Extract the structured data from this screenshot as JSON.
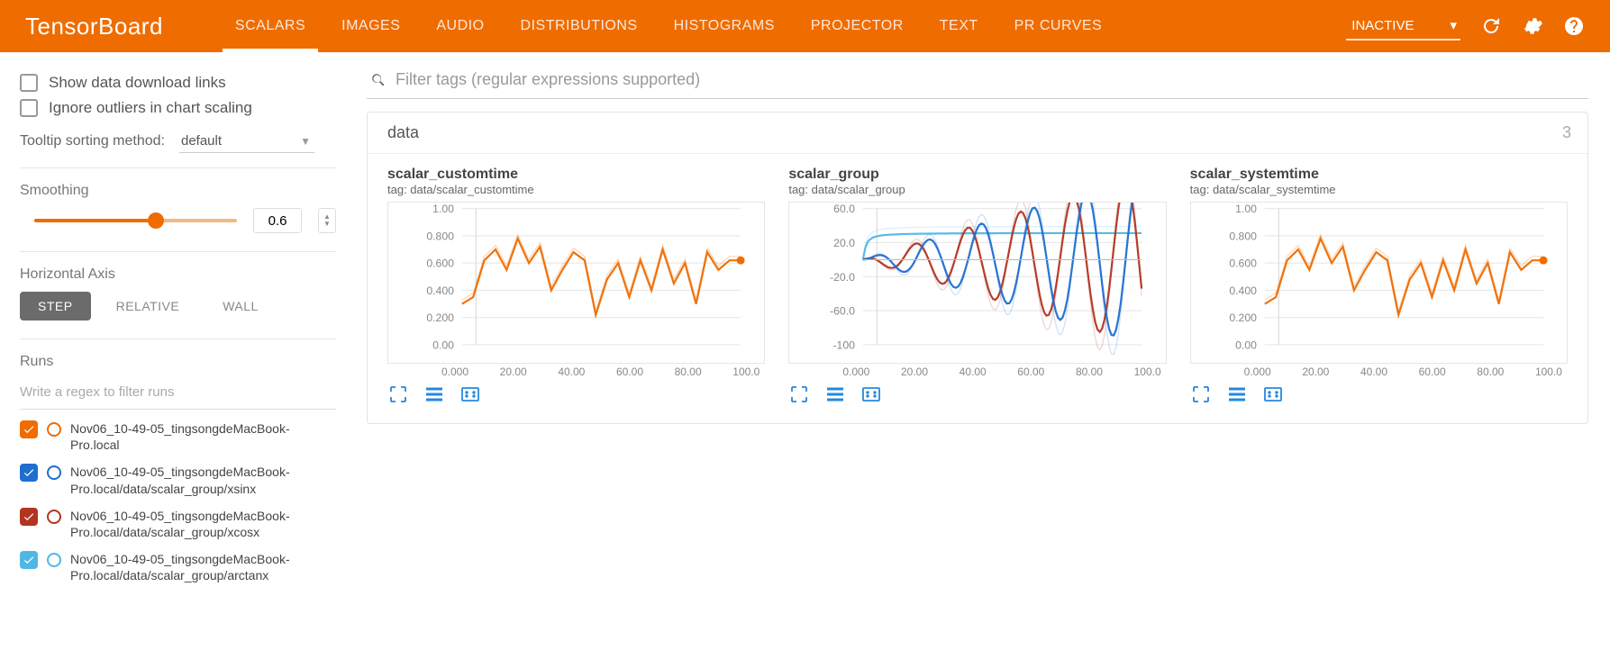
{
  "header": {
    "brand": "TensorBoard",
    "tabs": [
      "SCALARS",
      "IMAGES",
      "AUDIO",
      "DISTRIBUTIONS",
      "HISTOGRAMS",
      "PROJECTOR",
      "TEXT",
      "PR CURVES"
    ],
    "active_tab": 0,
    "inactive_label": "INACTIVE"
  },
  "sidebar": {
    "show_download": "Show data download links",
    "ignore_outliers": "Ignore outliers in chart scaling",
    "tooltip_label": "Tooltip sorting method:",
    "tooltip_value": "default",
    "smoothing_label": "Smoothing",
    "smoothing_value": "0.6",
    "smoothing_pct": 60,
    "haxis_label": "Horizontal Axis",
    "haxis_options": [
      "STEP",
      "RELATIVE",
      "WALL"
    ],
    "haxis_active": 0,
    "runs_label": "Runs",
    "runs_placeholder": "Write a regex to filter runs",
    "runs": [
      {
        "color": "#ef6c00",
        "label": "Nov06_10-49-05_tingsongdeMacBook-Pro.local"
      },
      {
        "color": "#1e6ecf",
        "label": "Nov06_10-49-05_tingsongdeMacBook-Pro.local/data/scalar_group/xsinx"
      },
      {
        "color": "#b23421",
        "label": "Nov06_10-49-05_tingsongdeMacBook-Pro.local/data/scalar_group/xcosx"
      },
      {
        "color": "#4fb7e6",
        "label": "Nov06_10-49-05_tingsongdeMacBook-Pro.local/data/scalar_group/arctanx"
      }
    ]
  },
  "content": {
    "filter_placeholder": "Filter tags (regular expressions supported)",
    "group_name": "data",
    "group_count": "3",
    "charts": [
      {
        "title": "scalar_customtime",
        "tag": "tag: data/scalar_customtime"
      },
      {
        "title": "scalar_group",
        "tag": "tag: data/scalar_group"
      },
      {
        "title": "scalar_systemtime",
        "tag": "tag: data/scalar_systemtime"
      }
    ]
  },
  "chart_data": [
    {
      "type": "line",
      "title": "scalar_customtime",
      "tag": "data/scalar_customtime",
      "xlim": [
        0,
        100
      ],
      "ylim": [
        0,
        1.0
      ],
      "yticks": [
        "1.00",
        "0.800",
        "0.600",
        "0.400",
        "0.200",
        "0.00"
      ],
      "xticks": [
        "0.000",
        "20.00",
        "40.00",
        "60.00",
        "80.00",
        "100.0"
      ],
      "series": [
        {
          "name": "Nov06_10-49-05",
          "color": "#ef6c00",
          "x": [
            0,
            4,
            8,
            12,
            16,
            20,
            24,
            28,
            32,
            36,
            40,
            44,
            48,
            52,
            56,
            60,
            64,
            68,
            72,
            76,
            80,
            84,
            88,
            92,
            96,
            100
          ],
          "values": [
            0.3,
            0.35,
            0.62,
            0.7,
            0.55,
            0.78,
            0.6,
            0.72,
            0.4,
            0.55,
            0.68,
            0.62,
            0.22,
            0.48,
            0.6,
            0.35,
            0.62,
            0.4,
            0.7,
            0.45,
            0.6,
            0.3,
            0.68,
            0.55,
            0.62,
            0.62
          ]
        }
      ]
    },
    {
      "type": "line",
      "title": "scalar_group",
      "tag": "data/scalar_group",
      "xlim": [
        0,
        100
      ],
      "ylim": [
        -100,
        60
      ],
      "yticks": [
        "60.0",
        "20.0",
        "-20.0",
        "-60.0",
        "-100"
      ],
      "xticks": [
        "0.000",
        "20.00",
        "40.00",
        "60.00",
        "80.00",
        "100.0"
      ],
      "series": [
        {
          "name": "xsinx",
          "color": "#1e6ecf"
        },
        {
          "name": "xcosx",
          "color": "#b23421"
        },
        {
          "name": "arctanx",
          "color": "#4fb7e6"
        }
      ],
      "envelope_description": "three interleaved growing-amplitude oscillations: x·sin(x), x·cos(x), arctan(x)"
    },
    {
      "type": "line",
      "title": "scalar_systemtime",
      "tag": "data/scalar_systemtime",
      "xlim": [
        0,
        100
      ],
      "ylim": [
        0,
        1.0
      ],
      "yticks": [
        "1.00",
        "0.800",
        "0.600",
        "0.400",
        "0.200",
        "0.00"
      ],
      "xticks": [
        "0.000",
        "20.00",
        "40.00",
        "60.00",
        "80.00",
        "100.0"
      ],
      "series": [
        {
          "name": "Nov06_10-49-05",
          "color": "#ef6c00",
          "x": [
            0,
            4,
            8,
            12,
            16,
            20,
            24,
            28,
            32,
            36,
            40,
            44,
            48,
            52,
            56,
            60,
            64,
            68,
            72,
            76,
            80,
            84,
            88,
            92,
            96,
            100
          ],
          "values": [
            0.3,
            0.35,
            0.62,
            0.7,
            0.55,
            0.78,
            0.6,
            0.72,
            0.4,
            0.55,
            0.68,
            0.62,
            0.22,
            0.48,
            0.6,
            0.35,
            0.62,
            0.4,
            0.7,
            0.45,
            0.6,
            0.3,
            0.68,
            0.55,
            0.62,
            0.62
          ]
        }
      ]
    }
  ]
}
